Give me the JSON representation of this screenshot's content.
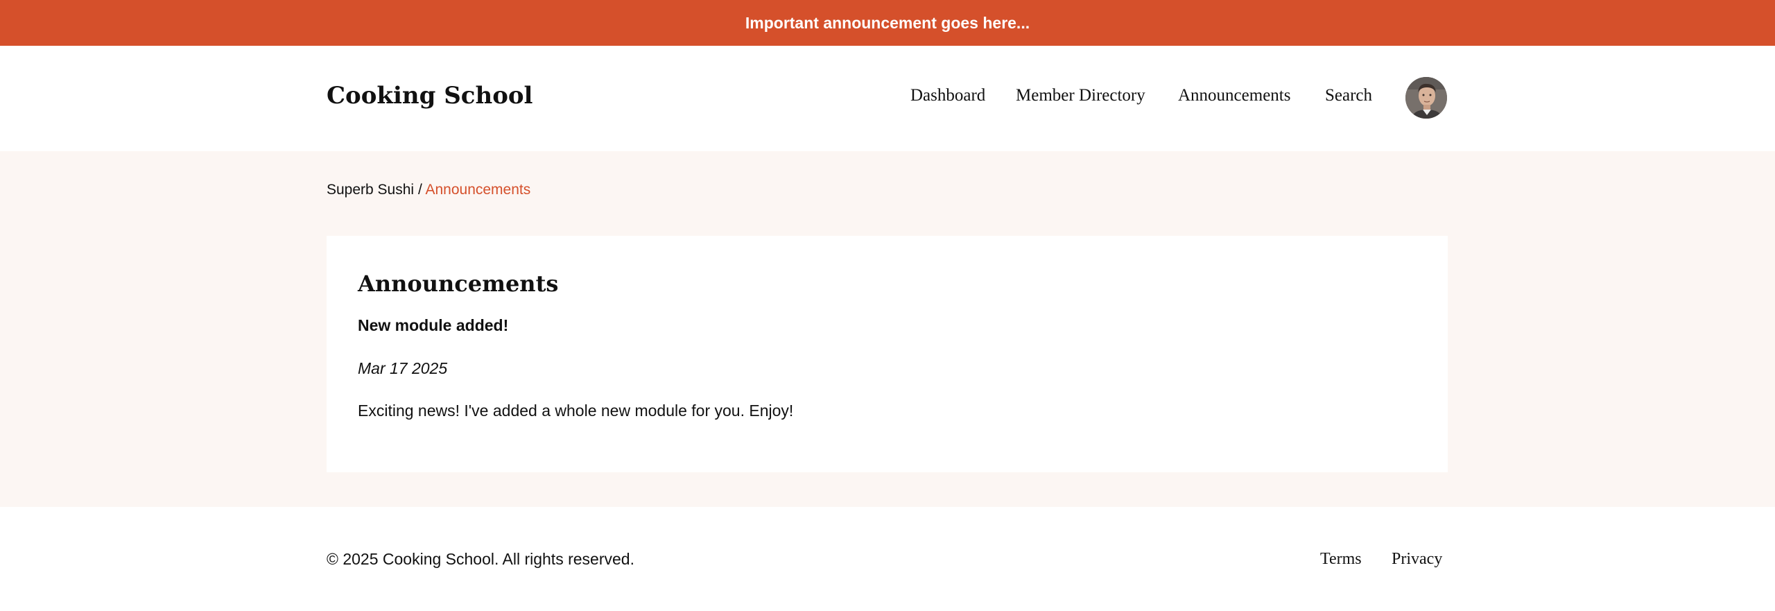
{
  "announcement_bar": {
    "text": "Important announcement goes here...",
    "background_color": "#d5502b"
  },
  "header": {
    "site_title": "Cooking School",
    "nav": [
      {
        "label": "Dashboard"
      },
      {
        "label": "Member Directory"
      },
      {
        "label": "Announcements"
      },
      {
        "label": "Search"
      }
    ],
    "avatar_icon": "user-avatar-photo"
  },
  "breadcrumb": {
    "parent": "Superb Sushi",
    "separator": "/",
    "current": "Announcements",
    "current_color": "#d5502b"
  },
  "main": {
    "heading": "Announcements",
    "post": {
      "title": "New module added!",
      "date": "Mar 17 2025",
      "body": "Exciting news! I've added a whole new module for you. Enjoy!"
    }
  },
  "footer": {
    "copyright": "© 2025 Cooking School. All rights reserved.",
    "links": [
      {
        "label": "Terms"
      },
      {
        "label": "Privacy"
      }
    ]
  },
  "colors": {
    "accent": "#d5502b",
    "content_background": "#fcf6f3",
    "text": "#111111"
  }
}
